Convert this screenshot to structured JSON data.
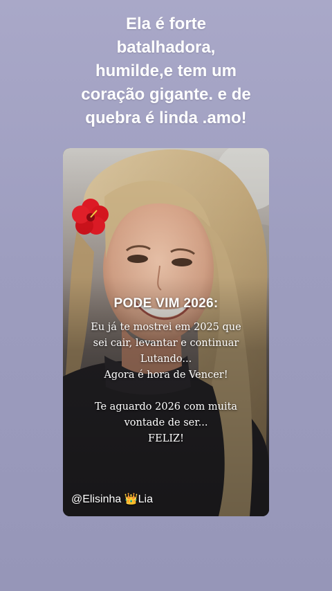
{
  "story": {
    "caption": "Ela é forte\nbatalhadora,\nhumilde,e tem um\ncoração  gigante. e de\nquebra é linda .amo!",
    "card": {
      "headline": "PODE VIM 2026:",
      "message": "Eu já te mostrei em 2025 que\nsei cair, levantar e continuar\nLutando...\nAgora é hora de Vencer!\n\nTe aguardo 2026 com muita\nvontade de ser...\nFELIZ!",
      "handle": "@Elisinha 👑Lia",
      "photo": "smiling-woman-with-red-hibiscus-in-hair"
    }
  }
}
